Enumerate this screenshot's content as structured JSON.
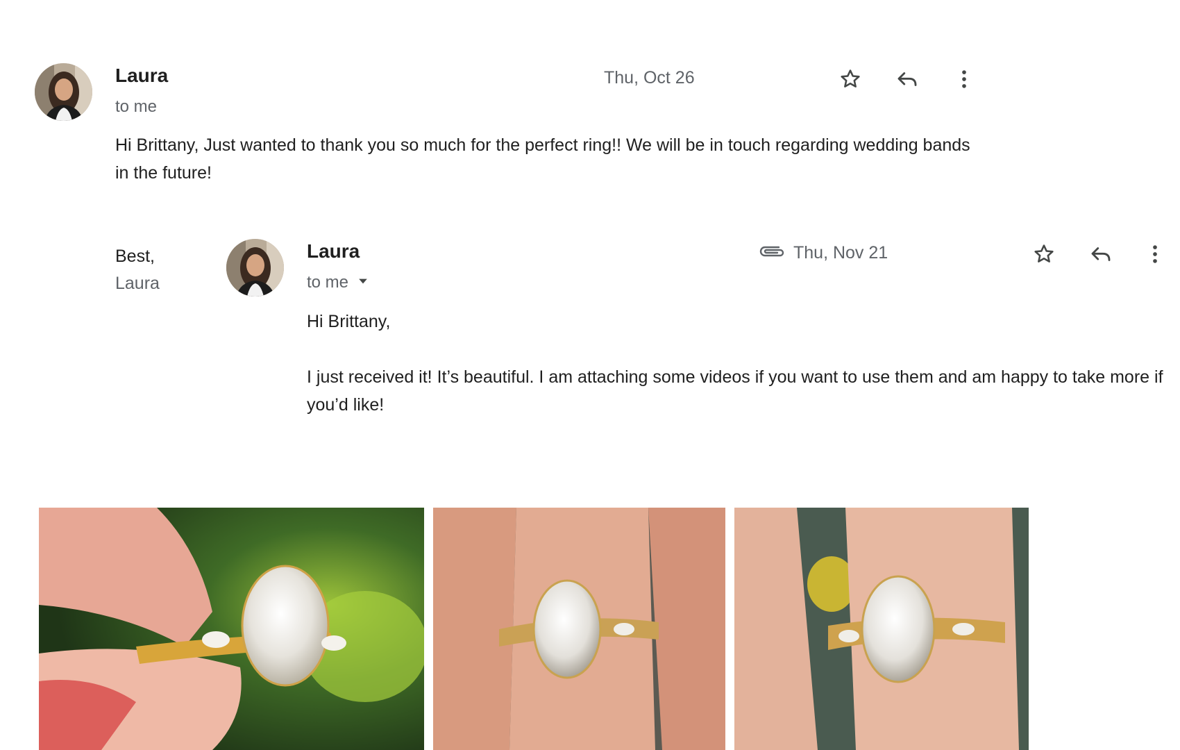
{
  "message1": {
    "sender": "Laura",
    "recipient": "to me",
    "date": "Thu, Oct 26",
    "body": "Hi Brittany, Just wanted to thank you so much for the perfect ring!! We will be in touch regarding wedding bands in the future!",
    "signoff": "Best,",
    "signature": "Laura"
  },
  "message2": {
    "sender": "Laura",
    "recipient": "to me",
    "date": "Thu, Nov 21",
    "greeting": "Hi Brittany,",
    "body": "I just received it! It’s beautiful. I am attaching some videos if you want to use them and am happy to take more if you’d like!"
  },
  "icons": {
    "star": "star-icon",
    "reply": "reply-icon",
    "more": "more-vert-icon",
    "attachment": "paperclip-icon",
    "dropdown": "caret-down-icon"
  },
  "colors": {
    "text_primary": "#1f1f1f",
    "text_secondary": "#5f6368",
    "icon": "#444746"
  }
}
